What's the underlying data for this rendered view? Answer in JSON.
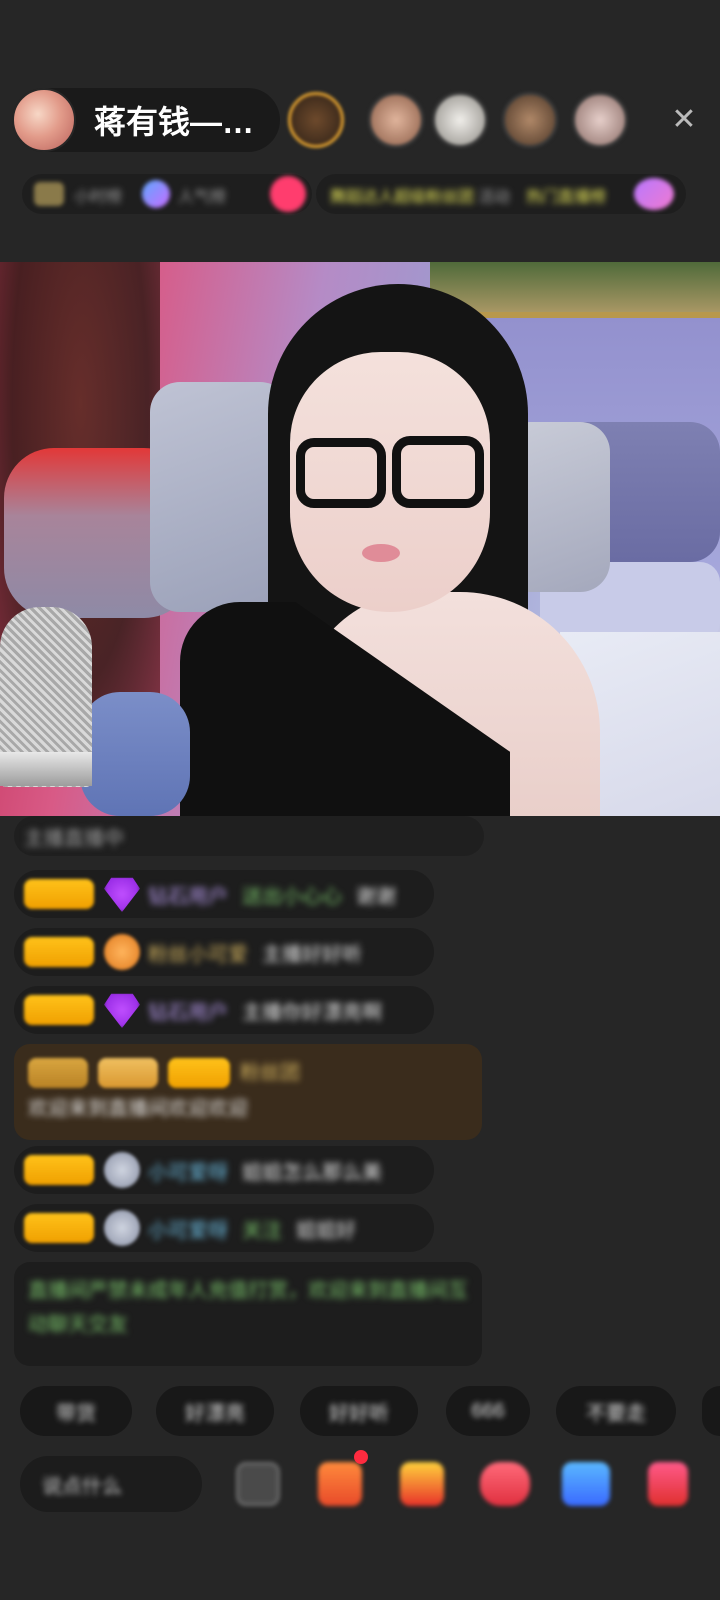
{
  "header": {
    "host_name": "蒋有钱—…",
    "close_label": "✕",
    "viewers": [
      {
        "name": "viewer-1",
        "color": "#6e4a2c",
        "gold": true
      },
      {
        "name": "viewer-2",
        "color": "#b88c74",
        "gold": false
      },
      {
        "name": "viewer-3",
        "color": "#d8d6d2",
        "gold": false
      },
      {
        "name": "viewer-4",
        "color": "#8a6a50",
        "gold": false
      },
      {
        "name": "viewer-5",
        "color": "#c7a8a0",
        "gold": false
      }
    ]
  },
  "tags": {
    "rank_label": "小时榜",
    "hot_label": "人气榜",
    "activity_1": "舞蹈达人",
    "activity_2": "超级粉丝团",
    "activity_3": "活动",
    "activity_4": "热门直播榜"
  },
  "chat": {
    "line_top": "主播直播中",
    "messages": [
      {
        "user": "钻石用户",
        "extra": "送出小心心",
        "text": "谢谢"
      },
      {
        "user": "粉丝小可爱",
        "text": "主播好好听"
      },
      {
        "user": "钻石用户",
        "text": "主播你好漂亮啊"
      },
      {
        "user": "粉丝团",
        "text": "欢迎来到直播间欢迎欢迎"
      },
      {
        "user": "小可爱呀",
        "text": "姐姐怎么那么美"
      },
      {
        "user": "小可爱呀",
        "extra": "关注",
        "text": "姐姐好"
      }
    ],
    "system_notice": "直播间严禁未成年人充值打赏，欢迎来到直播间互动聊天交友"
  },
  "quick_replies": [
    "带货",
    "好漂亮",
    "好好听",
    "666",
    "不要走"
  ],
  "bottom": {
    "input_placeholder": "说点什么"
  },
  "colors": {
    "background": "#262626",
    "badge_gold": "#ffc21a",
    "notice_bg": "#3a2c1c",
    "accent_red": "#ff2b3f"
  }
}
